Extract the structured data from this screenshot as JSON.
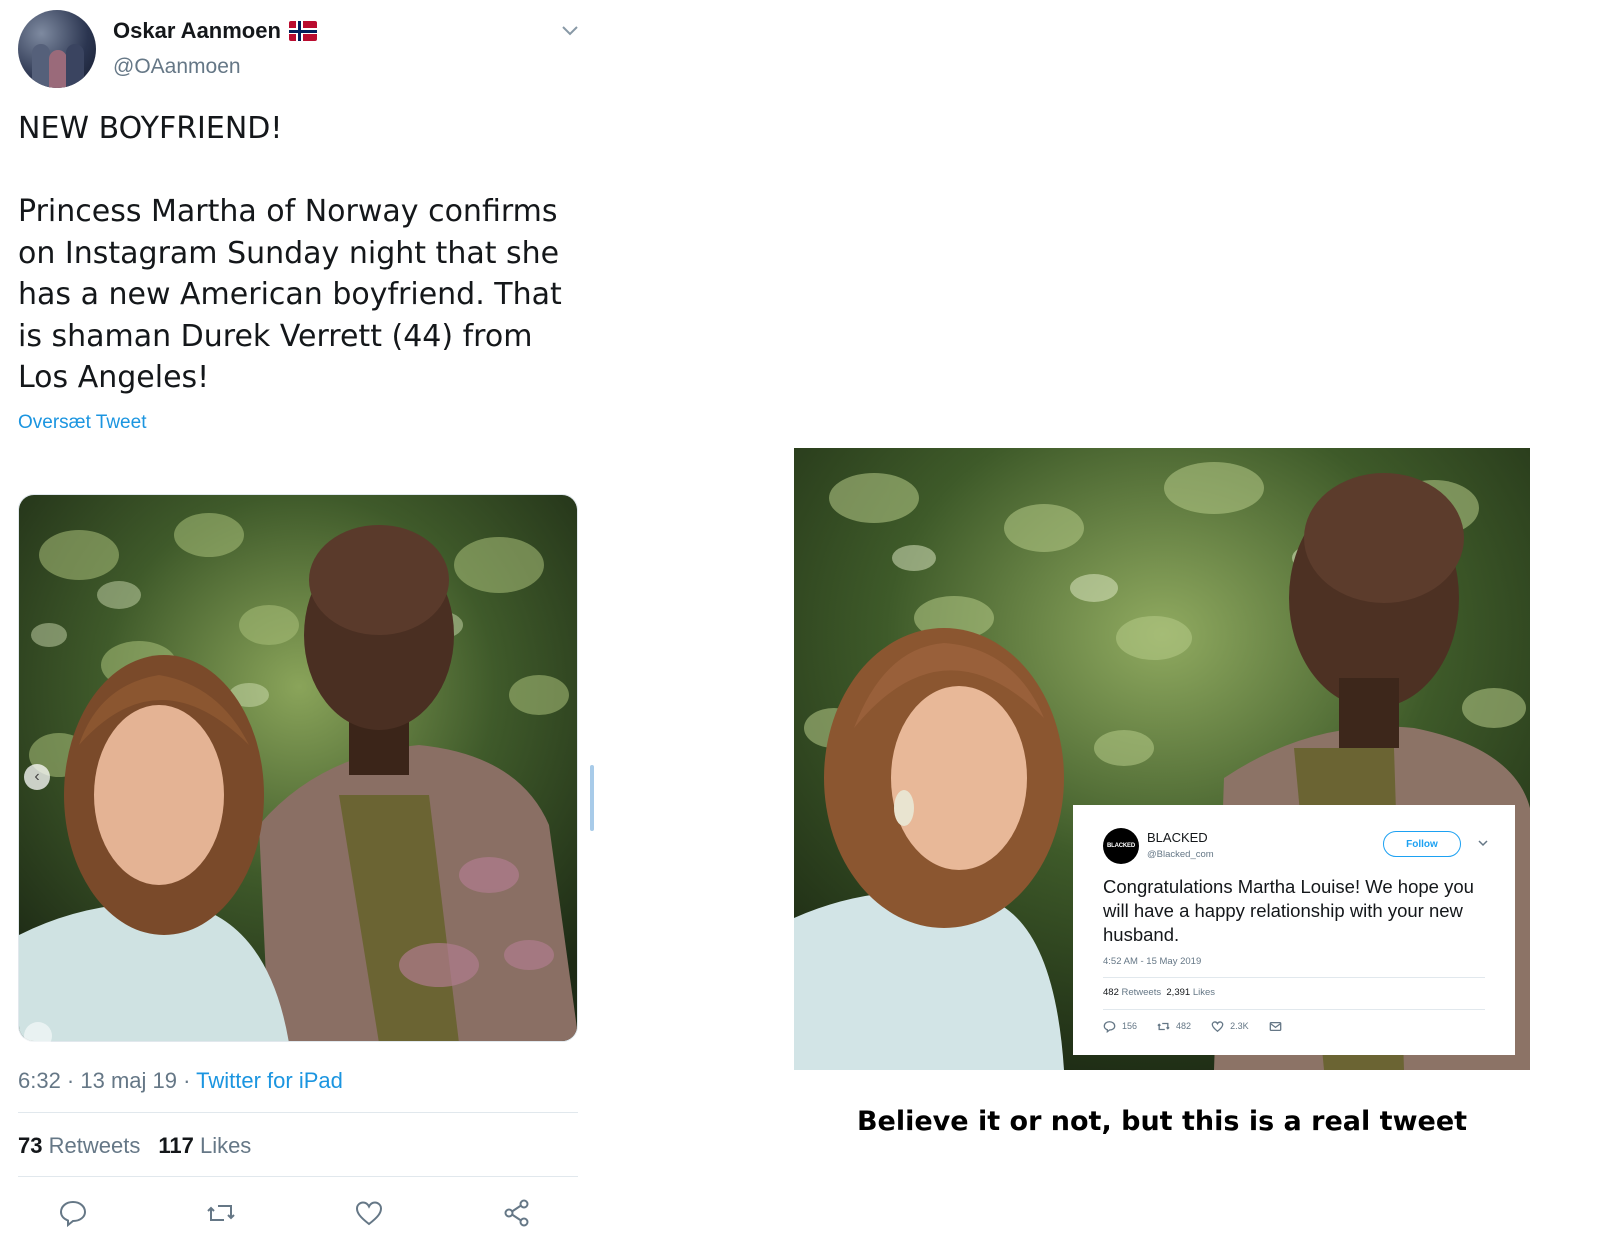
{
  "left_tweet": {
    "display_name": "Oskar Aanmoen",
    "handle": "@OAanmoen",
    "text_lines": [
      "NEW BOYFRIEND!",
      "Princess Martha of Norway confirms on Instagram Sunday night that she has a new American boyfriend. That is shaman Durek Verrett (44) from Los Angeles!"
    ],
    "translate_label": "Oversæt Tweet",
    "time": "6:32 · 13 maj 19 · ",
    "source": "Twitter for iPad",
    "retweet_count": "73",
    "retweet_label": "Retweets",
    "like_count": "117",
    "like_label": "Likes",
    "icons": [
      "avatar",
      "norway-flag-icon",
      "chevron-down-icon",
      "chevron-left-icon",
      "user-tag-icon",
      "reply-icon",
      "retweet-icon",
      "like-icon",
      "share-icon"
    ]
  },
  "right_image": {
    "embedded_tweet": {
      "avatar_text": "BLACKED",
      "name": "BLACKED",
      "handle": "@Blacked_com",
      "follow_label": "Follow",
      "text": "Congratulations Martha Louise! We hope you will have a happy relationship with your new husband.",
      "time": "4:52 AM - 15 May 2019",
      "retweets_count": "482",
      "retweets_label": "Retweets",
      "likes_count": "2,391",
      "likes_label": "Likes",
      "reply_count": "156",
      "retweet_action_count": "482",
      "like_action_count": "2.3K"
    },
    "caption": "Believe it or not, but this is a real tweet"
  },
  "colors": {
    "link_blue": "#1b95e0",
    "muted_gray": "#657786",
    "text_dark": "#14171a",
    "divider": "#e1e8ed"
  }
}
